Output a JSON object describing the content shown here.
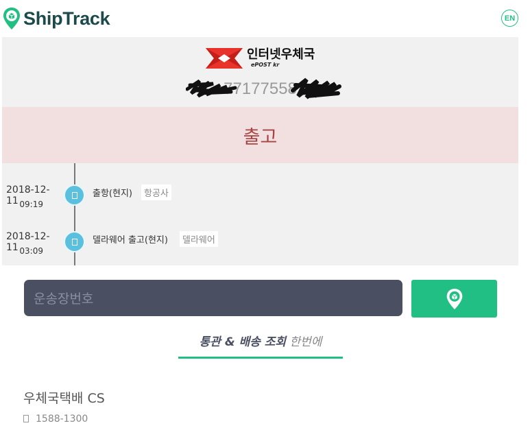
{
  "header": {
    "app_name": "ShipTrack",
    "logo_icon": "location-pin-box-icon",
    "lang_label": "EN",
    "accent_color": "#21bf84"
  },
  "carrier": {
    "name": "인터넷우체국",
    "sub": "ePOST kr",
    "tracking_number": "77177558",
    "tracking_redacted": true
  },
  "status": {
    "label": "출고",
    "color": "#a64444",
    "background": "#f2dfe0"
  },
  "events": [
    {
      "date": "2018-12-11",
      "time": "09:19",
      "description": "출항(현지)",
      "tag": "항공사",
      "icon": "box-icon"
    },
    {
      "date": "2018-12-11",
      "time": "03:09",
      "description": "델라웨어 출고(현지)",
      "tag": "델라웨어",
      "icon": "box-icon"
    }
  ],
  "search": {
    "placeholder": "운송장번호",
    "button_icon": "location-pin-box-icon"
  },
  "tagline": {
    "strong": "통관 & 배송 조회",
    "light": "한번에"
  },
  "cs": {
    "title": "우체국택배 CS",
    "phone": "1588-1300",
    "phone_icon": "phone-icon"
  }
}
